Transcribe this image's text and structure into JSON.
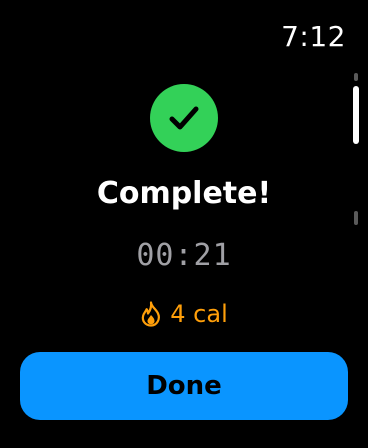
{
  "status_bar": {
    "time": "7:12"
  },
  "summary": {
    "status_icon": "checkmark-icon",
    "title": "Complete!",
    "elapsed_time": "00:21",
    "calories": {
      "icon": "flame-icon",
      "label": "4 cal"
    }
  },
  "actions": {
    "done_label": "Done"
  },
  "colors": {
    "background": "#000000",
    "success": "#33d158",
    "accent": "#0a95ff",
    "calories": "#ff9f0a",
    "muted_text": "#a0a0a5"
  }
}
